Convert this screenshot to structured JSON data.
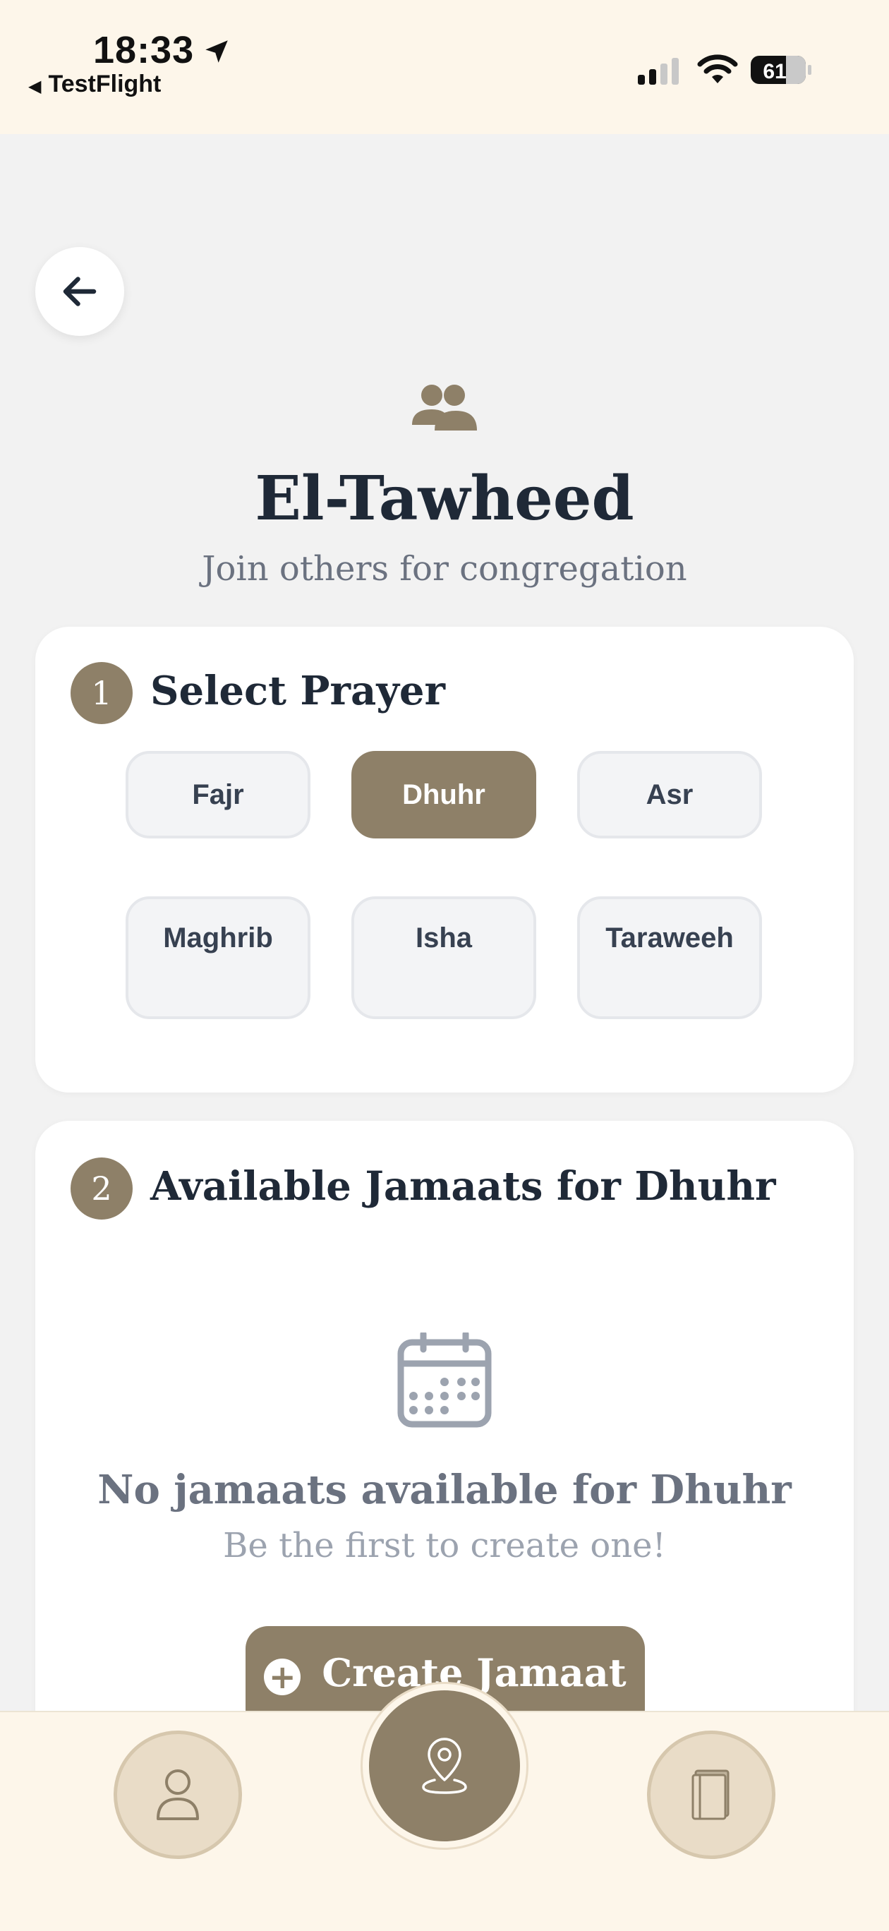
{
  "status_bar": {
    "time": "18:33",
    "back_app": "TestFlight",
    "battery": "61"
  },
  "header": {
    "title": "El-Tawheed",
    "subtitle": "Join others for congregation"
  },
  "select_prayer": {
    "step": "1",
    "title": "Select Prayer",
    "prayers": [
      {
        "label": "Fajr",
        "selected": false
      },
      {
        "label": "Dhuhr",
        "selected": true
      },
      {
        "label": "Asr",
        "selected": false
      },
      {
        "label": "Maghrib",
        "selected": false
      },
      {
        "label": "Isha",
        "selected": false
      },
      {
        "label": "Taraweeh",
        "selected": false
      }
    ]
  },
  "jamaats": {
    "step": "2",
    "title": "Available Jamaats for Dhuhr",
    "empty_title": "No jamaats available for Dhuhr",
    "empty_subtitle": "Be the first to create one!",
    "create_label": "Create Jamaat"
  },
  "bottom_nav": {
    "items": [
      {
        "icon": "person-icon"
      },
      {
        "icon": "location-pin-icon",
        "active": true
      },
      {
        "icon": "book-icon"
      }
    ]
  },
  "colors": {
    "accent": "#8e8068",
    "background": "#f2f2f2",
    "nav_background": "#fdf6ea",
    "nav_circle": "#e9dcc7"
  }
}
